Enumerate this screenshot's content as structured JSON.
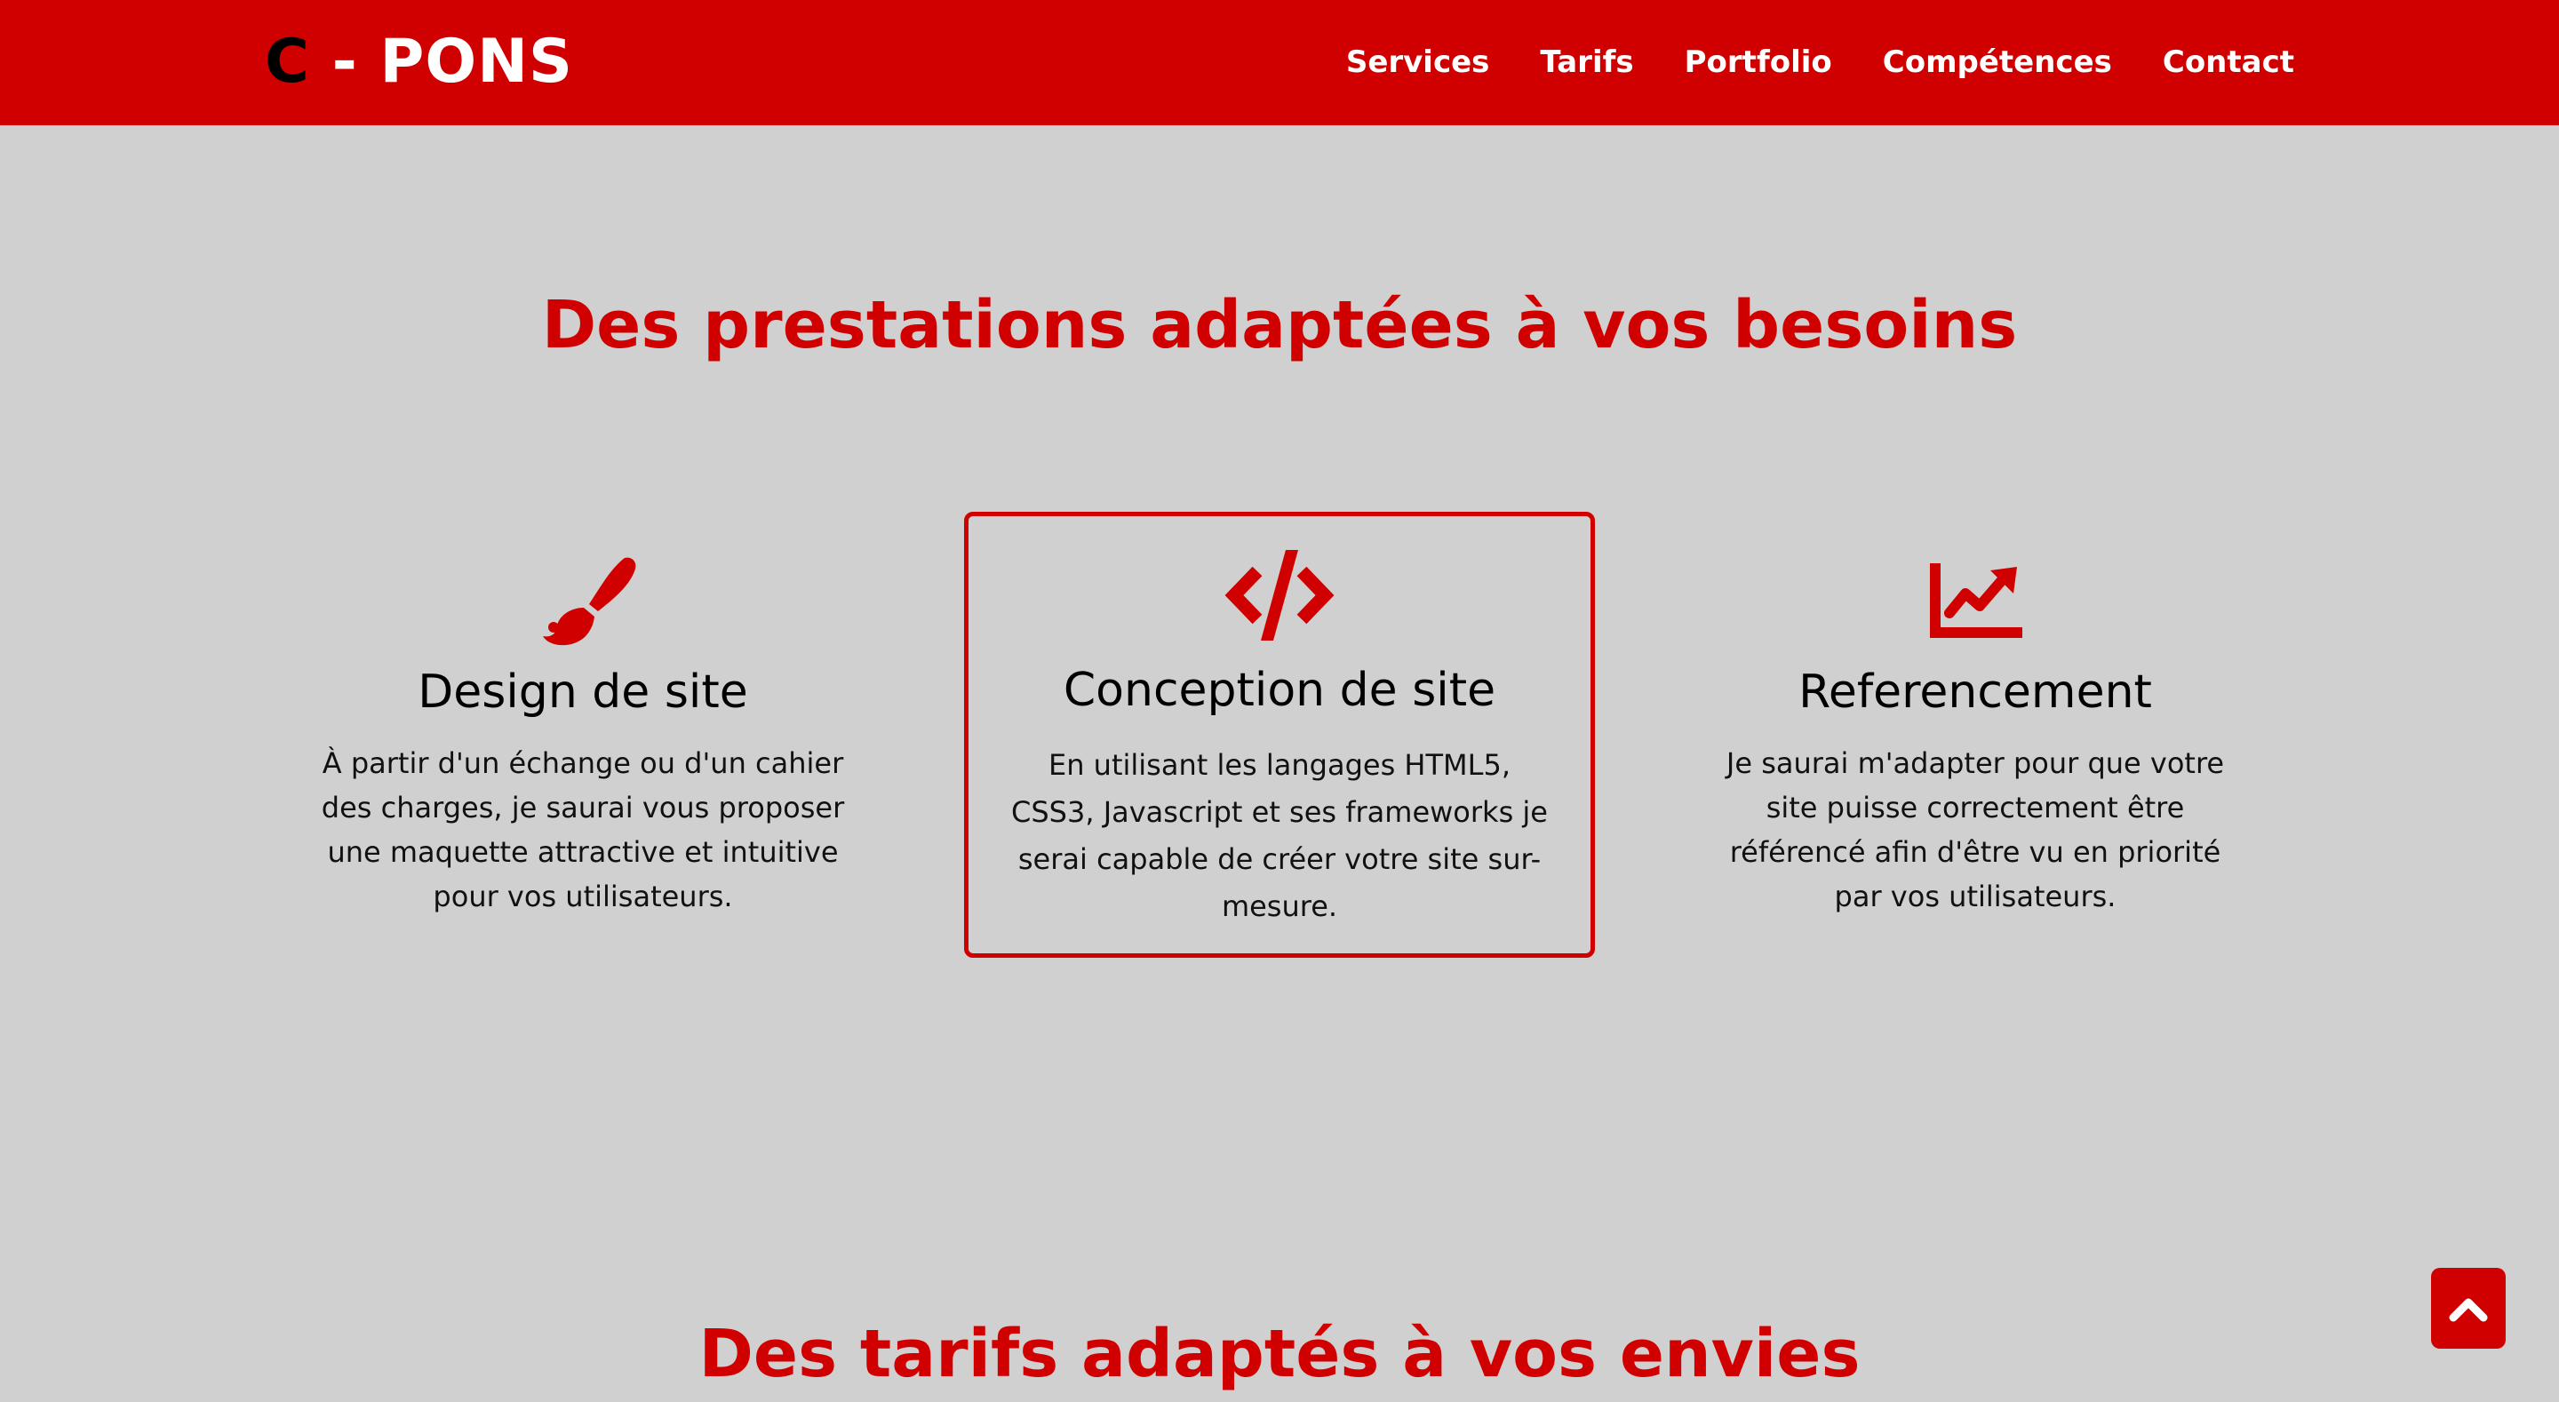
{
  "header": {
    "logo": {
      "c": "C",
      "dash": " - ",
      "rest": "PONS"
    },
    "nav": [
      "Services",
      "Tarifs",
      "Portfolio",
      "Compétences",
      "Contact"
    ]
  },
  "services": {
    "title": "Des prestations adaptées à vos besoins",
    "cards": [
      {
        "icon": "paintbrush-icon",
        "title": "Design de site",
        "text": "À partir d'un échange ou d'un cahier des charges, je saurai vous proposer une maquette attractive et intuitive pour vos utilisateurs."
      },
      {
        "icon": "code-icon",
        "title": "Conception de site",
        "text": "En utilisant les langages HTML5, CSS3, Javascript et ses frameworks je serai capable de créer votre site sur-mesure."
      },
      {
        "icon": "chart-line-icon",
        "title": "Referencement",
        "text": "Je saurai m'adapter pour que votre site puisse correctement être référencé afin d'être vu en priorité par vos utilisateurs."
      }
    ]
  },
  "pricing": {
    "title": "Des tarifs adaptés à vos envies"
  },
  "colors": {
    "accent": "#d10000",
    "background": "#d0d0d0",
    "text": "#000000"
  }
}
